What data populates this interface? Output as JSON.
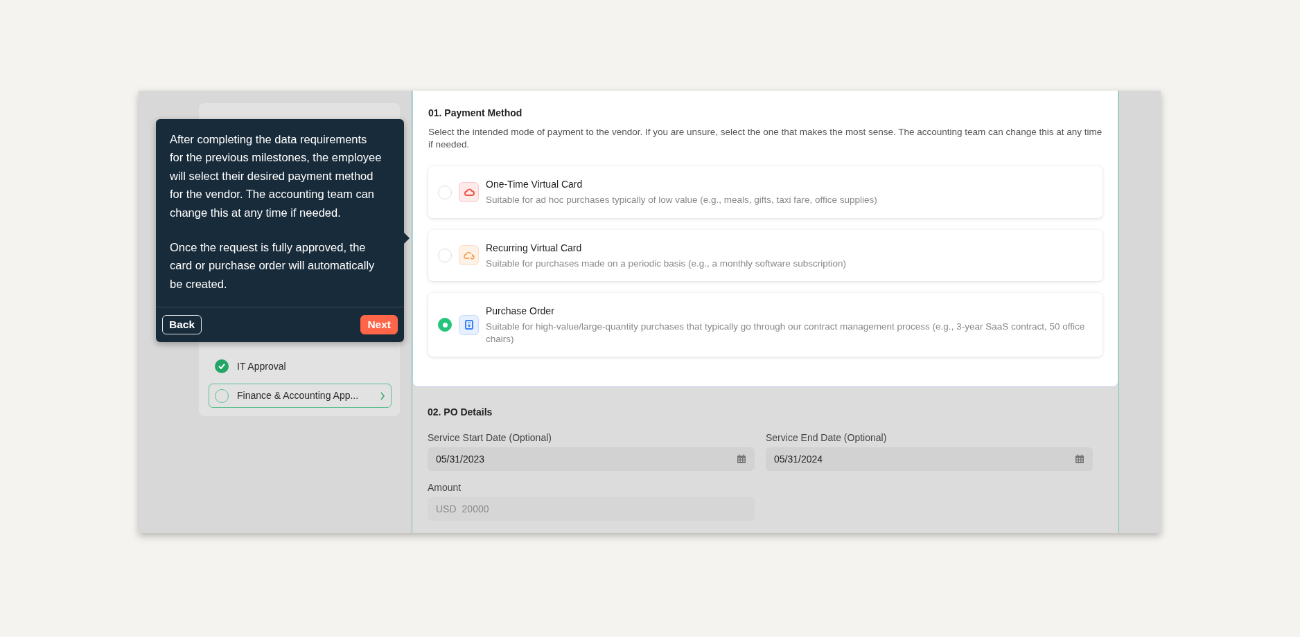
{
  "checklist": {
    "items": [
      {
        "label": "IT Approval",
        "checked": true,
        "selected": false
      },
      {
        "label": "Finance & Accounting App...",
        "checked": false,
        "selected": true
      }
    ]
  },
  "tour_tooltip": {
    "paragraphs": [
      "After completing the data requirements for the previous milestones, the employee will select their desired payment method for the vendor. The accounting team can change this at any time if needed.",
      "Once the request is fully approved, the card or purchase order will automatically be created."
    ],
    "buttons": [
      {
        "label": "Back",
        "kind": "secondary"
      },
      {
        "label": "Next",
        "kind": "primary"
      }
    ]
  },
  "payment_method": {
    "title": "01. Payment Method",
    "description": "Select the intended mode of payment to the vendor. If you are unsure, select the one that makes the most sense. The accounting team can change this at any time if needed.",
    "options": [
      {
        "title": "One-Time Virtual Card",
        "description": "Suitable for ad hoc purchases typically of low value (e.g., meals, gifts, taxi fare, office supplies)",
        "kind": "cloud",
        "color": "#f0564a",
        "selected": false
      },
      {
        "title": "Recurring Virtual Card",
        "description": "Suitable for purchases made on a periodic basis (e.g., a monthly software subscription)",
        "kind": "cloud-repeat",
        "color": "#f5923c",
        "selected": false
      },
      {
        "title": "Purchase Order",
        "description": "Suitable for high-value/large-quantity purchases that typically go through our contract management process (e.g., 3-year SaaS contract, 50 office chairs)",
        "kind": "document",
        "color": "#3b82f6",
        "selected": true
      }
    ]
  },
  "po_details": {
    "title": "02. PO Details",
    "fields": [
      {
        "label": "Service Start Date (Optional)",
        "value": "05/31/2023",
        "kind": "date",
        "disabled": false
      },
      {
        "label": "Service End Date (Optional)",
        "value": "05/31/2024",
        "kind": "date",
        "disabled": false
      },
      {
        "label": "Amount",
        "currency": "USD",
        "value": "20000",
        "kind": "amount",
        "disabled": true
      }
    ]
  }
}
